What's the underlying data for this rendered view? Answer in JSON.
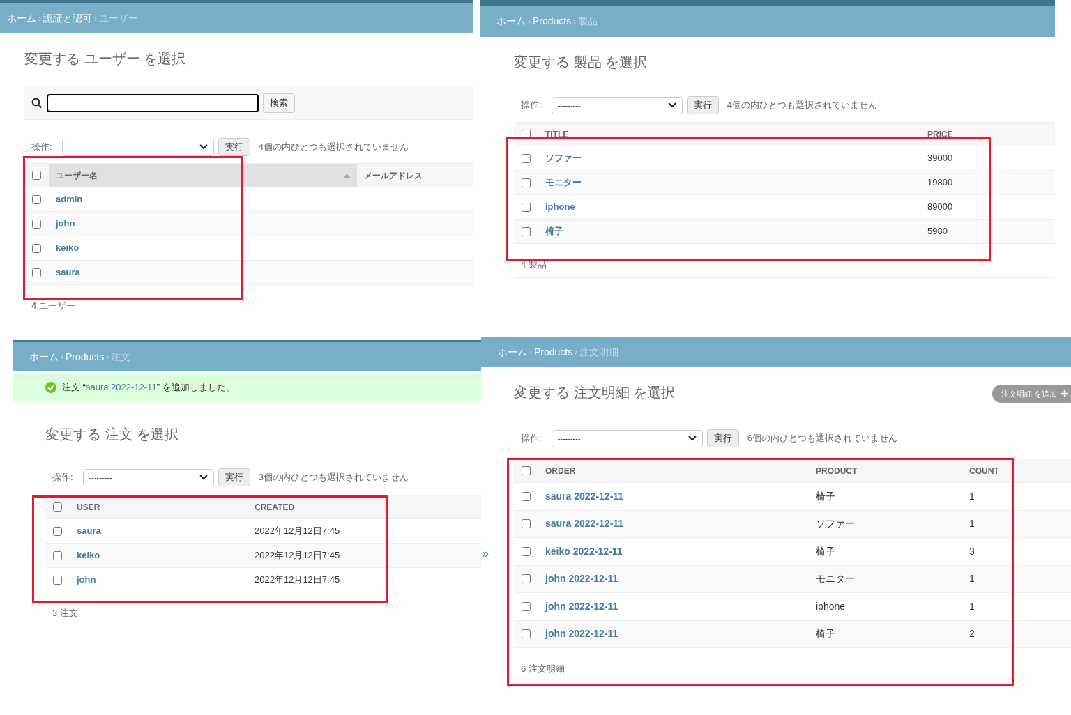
{
  "panels": [
    {
      "highlighted": true,
      "breadcrumb": [
        {
          "kind": "link",
          "text": "ホーム"
        },
        {
          "kind": "sep",
          "text": "›"
        },
        {
          "kind": "link",
          "text": "認証と認可"
        },
        {
          "kind": "sep",
          "text": "›"
        },
        {
          "kind": "current",
          "text": "ユーザー"
        }
      ],
      "title": "変更する ユーザー を選択",
      "search": {
        "button": "検索"
      },
      "actions": {
        "label": "操作:",
        "select": "---------",
        "button": "実行",
        "counter": "4個の内ひとつも選択されていません"
      },
      "all_checked": false,
      "columns": [
        {
          "label": "ユーザー名",
          "sorted": true
        },
        {
          "label": "メールアドレス",
          "sorted": false
        }
      ],
      "rows": [
        {
          "checked": false,
          "cells": [
            "admin"
          ]
        },
        {
          "checked": false,
          "cells": [
            "john"
          ]
        },
        {
          "checked": false,
          "cells": [
            "keiko"
          ]
        },
        {
          "checked": false,
          "cells": [
            "saura"
          ]
        }
      ],
      "footer": "4 ユーザー"
    },
    {
      "highlighted": true,
      "breadcrumb": [
        {
          "kind": "link",
          "text": "ホーム"
        },
        {
          "kind": "sep",
          "text": "›"
        },
        {
          "kind": "link",
          "text": "Products"
        },
        {
          "kind": "sep",
          "text": "›"
        },
        {
          "kind": "current",
          "text": "製品"
        }
      ],
      "title": "変更する 製品 を選択",
      "actions": {
        "label": "操作:",
        "select": "---------",
        "button": "実行",
        "counter": "4個の内ひとつも選択されていません"
      },
      "all_checked": false,
      "columns": [
        {
          "label": "TITLE",
          "sorted": false
        },
        {
          "label": "PRICE",
          "sorted": false
        }
      ],
      "rows": [
        {
          "checked": false,
          "cells": [
            "ソファー",
            "39000"
          ]
        },
        {
          "checked": false,
          "cells": [
            "モニター",
            "19800"
          ]
        },
        {
          "checked": false,
          "cells": [
            "iphone",
            "89000"
          ]
        },
        {
          "checked": false,
          "cells": [
            "椅子",
            "5980"
          ]
        }
      ],
      "footer": "4 製品"
    },
    {
      "highlighted": true,
      "breadcrumb": [
        {
          "kind": "link",
          "text": "ホーム"
        },
        {
          "kind": "sep",
          "text": "›"
        },
        {
          "kind": "link",
          "text": "Products"
        },
        {
          "kind": "sep",
          "text": "›"
        },
        {
          "kind": "current",
          "text": "注文"
        }
      ],
      "message": {
        "prefix": "注文 “",
        "link": "saura 2022-12-11",
        "suffix": "” を追加しました。"
      },
      "title": "変更する 注文 を選択",
      "actions": {
        "label": "操作:",
        "select": "---------",
        "button": "実行",
        "counter": "3個の内ひとつも選択されていません"
      },
      "all_checked": false,
      "columns": [
        {
          "label": "USER",
          "sorted": false
        },
        {
          "label": "CREATED",
          "sorted": false
        }
      ],
      "rows": [
        {
          "checked": false,
          "cells": [
            "saura",
            "2022年12月12日7:45"
          ]
        },
        {
          "checked": false,
          "cells": [
            "keiko",
            "2022年12月12日7:45"
          ]
        },
        {
          "checked": false,
          "cells": [
            "john",
            "2022年12月12日7:45"
          ]
        }
      ],
      "footer": "3 注文"
    },
    {
      "highlighted": true,
      "sidebar_toggle": "»",
      "breadcrumb": [
        {
          "kind": "link",
          "text": "ホーム"
        },
        {
          "kind": "sep",
          "text": "›"
        },
        {
          "kind": "link",
          "text": "Products"
        },
        {
          "kind": "sep",
          "text": "›"
        },
        {
          "kind": "current",
          "text": "注文明細"
        }
      ],
      "title": "変更する 注文明細 を選択",
      "add_button": "注文明細 を追加",
      "actions": {
        "label": "操作:",
        "select": "---------",
        "button": "実行",
        "counter": "6個の内ひとつも選択されていません"
      },
      "all_checked": false,
      "columns": [
        {
          "label": "ORDER",
          "sorted": false
        },
        {
          "label": "PRODUCT",
          "sorted": false
        },
        {
          "label": "COUNT",
          "sorted": false
        }
      ],
      "rows": [
        {
          "checked": false,
          "cells": [
            "saura 2022-12-11",
            "椅子",
            "1"
          ]
        },
        {
          "checked": false,
          "cells": [
            "saura 2022-12-11",
            "ソファー",
            "1"
          ]
        },
        {
          "checked": false,
          "cells": [
            "keiko 2022-12-11",
            "椅子",
            "3"
          ]
        },
        {
          "checked": false,
          "cells": [
            "john 2022-12-11",
            "モニター",
            "1"
          ]
        },
        {
          "checked": false,
          "cells": [
            "john 2022-12-11",
            "iphone",
            "1"
          ]
        },
        {
          "checked": false,
          "cells": [
            "john 2022-12-11",
            "椅子",
            "2"
          ]
        }
      ],
      "footer": "6 注文明細"
    }
  ]
}
